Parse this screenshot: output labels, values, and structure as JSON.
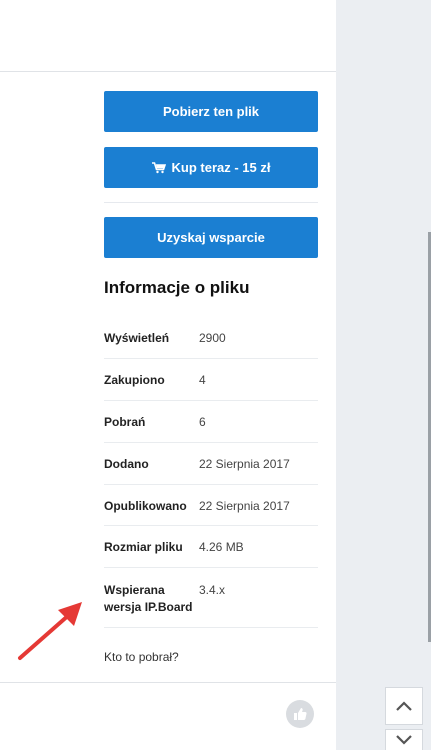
{
  "actions": {
    "download_label": "Pobierz ten plik",
    "buy_label": "Kup teraz - 15 zł",
    "support_label": "Uzyskaj wsparcie"
  },
  "file_info": {
    "title": "Informacje o pliku",
    "rows": [
      {
        "key": "Wyświetleń",
        "value": "2900"
      },
      {
        "key": "Zakupiono",
        "value": "4"
      },
      {
        "key": "Pobrań",
        "value": "6"
      },
      {
        "key": "Dodano",
        "value": "22 Sierpnia 2017"
      },
      {
        "key": "Opublikowano",
        "value": "22 Sierpnia 2017"
      },
      {
        "key": "Rozmiar pliku",
        "value": "4.26 MB"
      },
      {
        "key_line1": "Wspierana",
        "key_line2": "wersja IP.Board",
        "value": "3.4.x"
      }
    ],
    "who_downloaded_label": "Kto to pobrał?"
  },
  "colors": {
    "accent": "#1b7fd2",
    "annotation_arrow": "#e53935"
  },
  "icons": {
    "cart": "cart-icon",
    "like": "thumbs-up-icon",
    "scroll_up": "chevron-up-icon",
    "scroll_down": "chevron-down-icon"
  }
}
